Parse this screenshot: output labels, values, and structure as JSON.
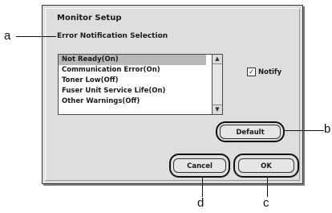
{
  "dialog": {
    "title": "Monitor Setup",
    "section_label": "Error Notification Selection",
    "list_items": [
      "Not Ready(On)",
      "Communication Error(On)",
      "Toner Low(Off)",
      "Fuser Unit Service Life(On)",
      "Other Warnings(Off)"
    ],
    "selected_index": 0,
    "notify": {
      "label": "Notify",
      "checked": true
    },
    "buttons": {
      "default": "Default",
      "cancel": "Cancel",
      "ok": "OK"
    },
    "scroll_up_glyph": "▲",
    "scroll_down_glyph": "▼",
    "check_glyph": "✓"
  },
  "callouts": {
    "a": "a",
    "b": "b",
    "c": "c",
    "d": "d"
  }
}
